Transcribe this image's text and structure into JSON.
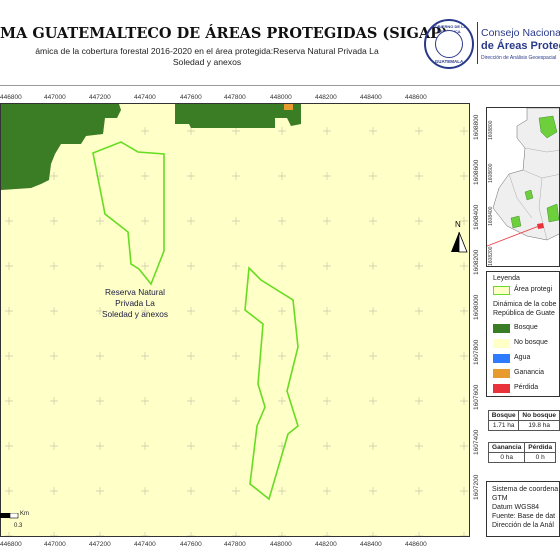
{
  "header": {
    "title": "MA GUATEMALTECO DE ÁREAS PROTEGIDAS  (SIGAP)",
    "subtitle_line1": "ámica de la cobertura forestal 2016-2020 en el área protegida:Reserva Natural Privada La",
    "subtitle_line2": "Soledad y anexos"
  },
  "logo": {
    "seal_top": "GOBIERNO DE LA REPÚBLICA",
    "seal_bottom": "GUATEMALA",
    "name_line1": "Consejo Nacional",
    "name_line2": "de Áreas Protegidas",
    "name_line3": "Dirección de Análisis Geoespacial"
  },
  "map": {
    "x_ticks": [
      "446800",
      "447000",
      "447200",
      "447400",
      "447600",
      "447800",
      "448000",
      "448200",
      "448400",
      "448600"
    ],
    "y_ticks": [
      "1608800",
      "1608600",
      "1608400",
      "1608200",
      "1608000",
      "1607800",
      "1607600",
      "1607400",
      "1607200"
    ],
    "protected_area_label": [
      "Reserva Natural",
      "Privada La",
      "Soledad y anexos"
    ],
    "north_symbol": "N",
    "colors": {
      "background": "#ffffc8",
      "bosque": "#3a7d24",
      "boundary": "#66dd22",
      "ganancia": "#e79b2e",
      "grid_cross": "#c9c9a8"
    }
  },
  "inset": {
    "y_ticks": [
      "1608800",
      "1608600",
      "1608400",
      "1608200"
    ]
  },
  "legend": {
    "title": "Leyenda",
    "area_label": "Área protegi",
    "subtitle_line1": "Dinámica de la cobe",
    "subtitle_line2": "República de Guate",
    "items": [
      {
        "label": "Bosque",
        "color": "#3a7d24"
      },
      {
        "label": "No bosque",
        "color": "#ffffc8"
      },
      {
        "label": "Agua",
        "color": "#2f7bff"
      },
      {
        "label": "Ganancia",
        "color": "#e79b2e"
      },
      {
        "label": "Pérdida",
        "color": "#e8333a"
      }
    ]
  },
  "stats1": {
    "headers": [
      "Bosque",
      "No bosque"
    ],
    "values": [
      "1.71 ha",
      "19.8 ha"
    ]
  },
  "stats2": {
    "headers": [
      "Ganancia",
      "Pérdida"
    ],
    "values": [
      "0 ha",
      "0 h"
    ]
  },
  "info": {
    "lines": [
      "Sistema de coordena",
      "GTM",
      "Datum WGS84",
      "Fuente: Base de dat",
      "Dirección de la Anál"
    ]
  },
  "scale": {
    "unit": "Km",
    "value": "0.3"
  }
}
